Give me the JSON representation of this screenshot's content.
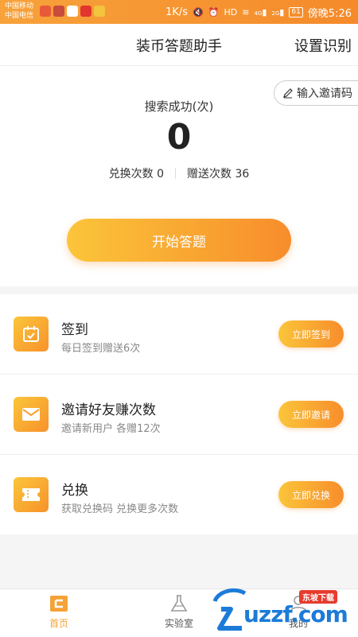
{
  "status_bar": {
    "carrier_1": "中国移动",
    "carrier_2": "中国电信",
    "net_speed": "1K/s",
    "signal_1": "4G",
    "signal_2": "2G",
    "battery": "61",
    "time": "傍晚5:26",
    "hd": "HD"
  },
  "header": {
    "title": "装币答题助手",
    "settings_label": "设置识别"
  },
  "summary": {
    "invite_code_label": "输入邀请码",
    "search_label": "搜索成功(次)",
    "search_count": "0",
    "exchange_count_text": "兑换次数 0",
    "gift_count_text": "赠送次数 36",
    "start_button": "开始答题"
  },
  "tasks": [
    {
      "icon": "calendar-check-icon",
      "title": "签到",
      "desc": "每日签到赠送6次",
      "button": "立即签到"
    },
    {
      "icon": "envelope-icon",
      "title": "邀请好友赚次数",
      "desc": "邀请新用户 各赠12次",
      "button": "立即邀请"
    },
    {
      "icon": "ticket-icon",
      "title": "兑换",
      "desc": "获取兑换码 兑换更多次数",
      "button": "立即兑换"
    }
  ],
  "nav": {
    "home": "首页",
    "lab": "实验室",
    "mine": "我的"
  },
  "watermark": {
    "text": "uzzf.com",
    "tag": "东坡下载"
  },
  "colors": {
    "accent": "#f78d2b",
    "accent_light": "#fbc53a",
    "status_bar": "#f58a2a"
  }
}
